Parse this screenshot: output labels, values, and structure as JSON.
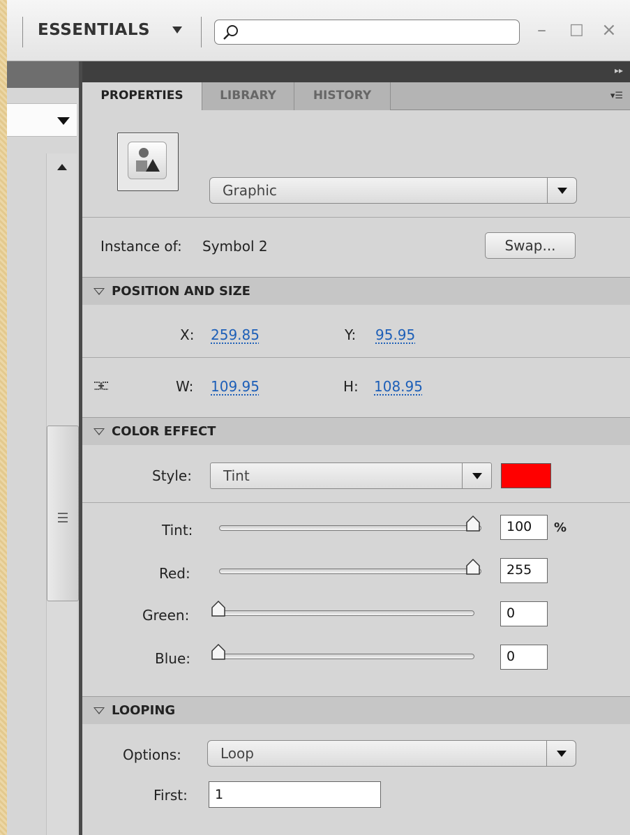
{
  "topbar": {
    "workspace_label": "ESSENTIALS",
    "search_value": "",
    "minimize_glyph": "–",
    "maximize_glyph": "□",
    "close_glyph": "×"
  },
  "tabs": [
    {
      "label": "PROPERTIES",
      "active": true
    },
    {
      "label": "LIBRARY",
      "active": false
    },
    {
      "label": "HISTORY",
      "active": false
    }
  ],
  "symbol": {
    "behavior": "Graphic",
    "instance_label": "Instance of:",
    "instance_name": "Symbol 2",
    "swap_label": "Swap..."
  },
  "position_size": {
    "title": "POSITION AND SIZE",
    "x_label": "X:",
    "x_value": "259.85",
    "y_label": "Y:",
    "y_value": "95.95",
    "w_label": "W:",
    "w_value": "109.95",
    "h_label": "H:",
    "h_value": "108.95"
  },
  "color_effect": {
    "title": "COLOR EFFECT",
    "style_label": "Style:",
    "style_value": "Tint",
    "tint_color": "#ff0000",
    "tint_label": "Tint:",
    "tint_value": "100",
    "tint_unit": "%",
    "red_label": "Red:",
    "red_value": "255",
    "green_label": "Green:",
    "green_value": "0",
    "blue_label": "Blue:",
    "blue_value": "0"
  },
  "looping": {
    "title": "LOOPING",
    "options_label": "Options:",
    "options_value": "Loop",
    "first_label": "First:",
    "first_value": "1"
  }
}
